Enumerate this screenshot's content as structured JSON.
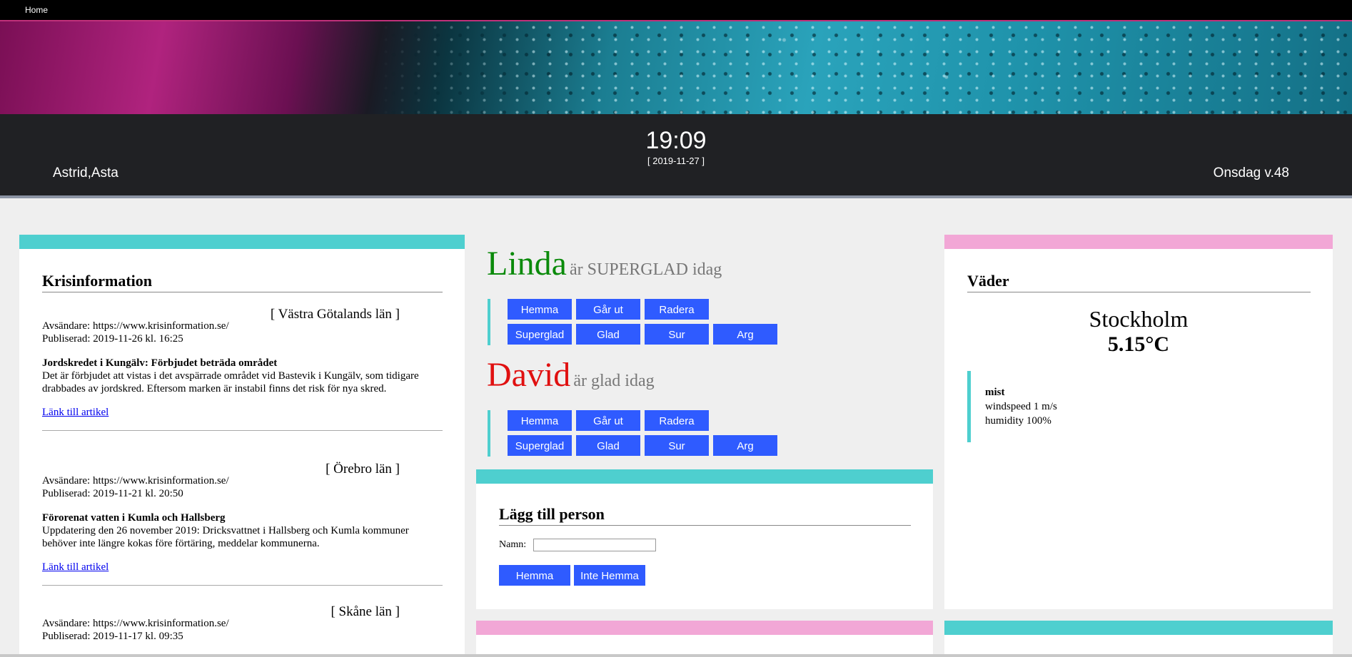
{
  "nav": {
    "home_label": "Home"
  },
  "header": {
    "time": "19:09",
    "date": "[ 2019-11-27 ]",
    "names": "Astrid,Asta",
    "weekday": "Onsdag v.48"
  },
  "krisinformation": {
    "title": "Krisinformation",
    "items": [
      {
        "lan": "[ Västra Götalands län ]",
        "sender": "Avsändare: https://www.krisinformation.se/",
        "published": "Publiserad: 2019-11-26 kl. 16:25",
        "headline": "Jordskredet i Kungälv: Förbjudet beträda området",
        "body": "Det är förbjudet att vistas i det avspärrade området vid Bastevik i Kungälv, som tidigare drabbades av jordskred. Eftersom marken är instabil finns det risk för nya skred.",
        "link": "Länk till artikel"
      },
      {
        "lan": "[ Örebro län ]",
        "sender": "Avsändare: https://www.krisinformation.se/",
        "published": "Publiserad: 2019-11-21 kl. 20:50",
        "headline": "Förorenat vatten i Kumla och Hallsberg",
        "body": "Uppdatering den 26 november 2019: Dricksvattnet i Hallsberg och Kumla kommuner behöver inte längre kokas före förtäring, meddelar kommunerna.",
        "link": "Länk till artikel"
      },
      {
        "lan": "[ Skåne län ]",
        "sender": "Avsändare: https://www.krisinformation.se/",
        "published": "Publiserad: 2019-11-17 kl. 09:35"
      }
    ]
  },
  "persons": [
    {
      "name": "Linda",
      "name_color": "#0a8a0a",
      "status": "är SUPERGLAD idag",
      "buttons_row1": [
        "Hemma",
        "Går ut",
        "Radera"
      ],
      "buttons_row2": [
        "Superglad",
        "Glad",
        "Sur",
        "Arg"
      ]
    },
    {
      "name": "David",
      "name_color": "#e01010",
      "status": "är glad idag",
      "buttons_row1": [
        "Hemma",
        "Går ut",
        "Radera"
      ],
      "buttons_row2": [
        "Superglad",
        "Glad",
        "Sur",
        "Arg"
      ]
    }
  ],
  "add_person": {
    "title": "Lägg till person",
    "name_label": "Namn:",
    "name_value": "",
    "btn_home": "Hemma",
    "btn_not_home": "Inte Hemma"
  },
  "weather": {
    "title": "Väder",
    "city": "Stockholm",
    "temperature": "5.15°C",
    "description": "mist",
    "wind": "windspeed 1 m/s",
    "humidity": "humidity 100%"
  },
  "colors": {
    "accent_teal": "#4ecfcf",
    "accent_pink": "#f2a7d6",
    "button_blue": "#2f5bff",
    "header_bg": "#202124"
  }
}
